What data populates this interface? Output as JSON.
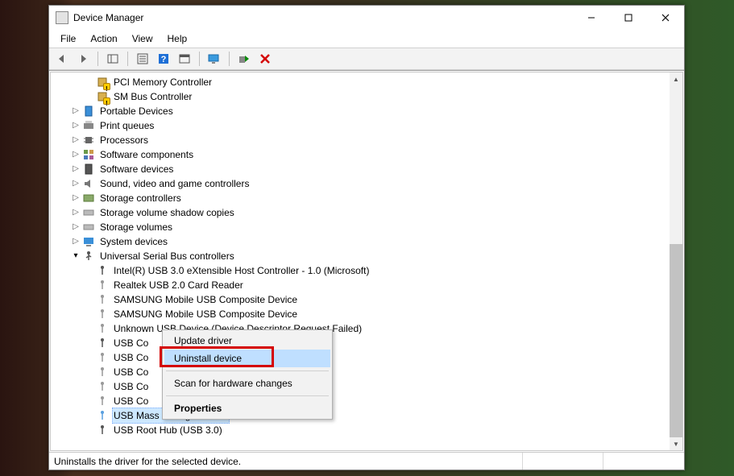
{
  "window": {
    "title": "Device Manager"
  },
  "menu": {
    "file": "File",
    "action": "Action",
    "view": "View",
    "help": "Help"
  },
  "tree": {
    "pci_memory": "PCI Memory Controller",
    "sm_bus": "SM Bus Controller",
    "portable_devices": "Portable Devices",
    "print_queues": "Print queues",
    "processors": "Processors",
    "software_components": "Software components",
    "software_devices": "Software devices",
    "sound": "Sound, video and game controllers",
    "storage_controllers": "Storage controllers",
    "storage_volume_shadow": "Storage volume shadow copies",
    "storage_volumes": "Storage volumes",
    "system_devices": "System devices",
    "usb_controllers": "Universal Serial Bus controllers",
    "intel_usb3": "Intel(R) USB 3.0 eXtensible Host Controller - 1.0 (Microsoft)",
    "realtek_card": "Realtek USB 2.0 Card Reader",
    "samsung1": "SAMSUNG Mobile USB Composite Device",
    "samsung2": "SAMSUNG Mobile USB Composite Device",
    "unknown_usb": "Unknown USB Device (Device Descriptor Request Failed)",
    "usb_co1": "USB Co",
    "usb_co2": "USB Co",
    "usb_co3": "USB Co",
    "usb_co4": "USB Co",
    "usb_co5": "USB Co",
    "usb_mass": "USB Mass Storage Device",
    "usb_root": "USB Root Hub (USB 3.0)"
  },
  "context_menu": {
    "update": "Update driver",
    "uninstall": "Uninstall device",
    "scan": "Scan for hardware changes",
    "properties": "Properties"
  },
  "status": {
    "text": "Uninstalls the driver for the selected device."
  }
}
